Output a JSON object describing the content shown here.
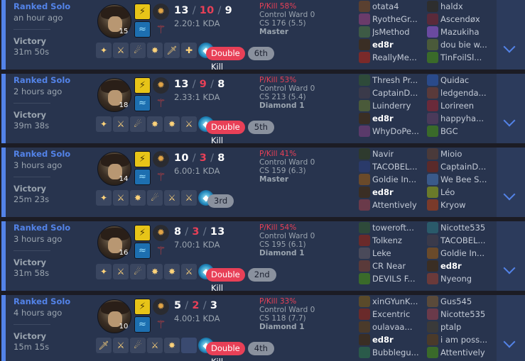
{
  "matches": [
    {
      "queue": "Ranked Solo",
      "ago": "an hour ago",
      "result": "Victory",
      "duration": "31m 50s",
      "level": "15",
      "kills": "13",
      "deaths": "10",
      "assists": "9",
      "kda": "2.20:1 KDA",
      "pkill": "P/Kill 58%",
      "control_ward": "Control Ward 0",
      "cs": "CS 176 (5.5)",
      "tier": "Master",
      "multikill": "Double Kill",
      "placement": "6th",
      "items": [
        "✦",
        "⚔",
        "☄",
        "✸",
        "🗡",
        "✚",
        "◆"
      ],
      "team1": [
        {
          "name": "otata4",
          "color": "#5a4030"
        },
        {
          "name": "RyotheGr...",
          "color": "#6a3b6a"
        },
        {
          "name": "JsMethod",
          "color": "#3d5a45"
        },
        {
          "name": "ed8r",
          "color": "#3a2e24",
          "me": true
        },
        {
          "name": "ReallyMe...",
          "color": "#7a2a2a"
        }
      ],
      "team2": [
        {
          "name": "haldx",
          "color": "#2e2e2e"
        },
        {
          "name": "Ascendøx",
          "color": "#5a2a3a"
        },
        {
          "name": "Mazukiha",
          "color": "#6a4aa0"
        },
        {
          "name": "dou bie w...",
          "color": "#4a5a3a"
        },
        {
          "name": "TinFoilSl...",
          "color": "#3a6a2a"
        }
      ]
    },
    {
      "queue": "Ranked Solo",
      "ago": "2 hours ago",
      "result": "Victory",
      "duration": "39m 38s",
      "level": "18",
      "kills": "13",
      "deaths": "9",
      "assists": "8",
      "kda": "2.33:1 KDA",
      "pkill": "P/Kill 53%",
      "control_ward": "Control Ward 0",
      "cs": "CS 213 (5.4)",
      "tier": "Diamond 1",
      "multikill": "Double Kill",
      "placement": "5th",
      "items": [
        "✦",
        "⚔",
        "☄",
        "✸",
        "✸",
        "⚔",
        "◆"
      ],
      "team1": [
        {
          "name": "Thresh Pr...",
          "color": "#2e4a3a"
        },
        {
          "name": "CaptainD...",
          "color": "#3a3a4a"
        },
        {
          "name": "Luinderry",
          "color": "#4a5a3a"
        },
        {
          "name": "ed8r",
          "color": "#3a2e24",
          "me": true
        },
        {
          "name": "WhyDoPe...",
          "color": "#5a3a6a"
        }
      ],
      "team2": [
        {
          "name": "Quidac",
          "color": "#2a4a8a"
        },
        {
          "name": "ledgenda...",
          "color": "#5a3a3a"
        },
        {
          "name": "Lorireen",
          "color": "#6a2a3a"
        },
        {
          "name": "happyha...",
          "color": "#4a3a5a"
        },
        {
          "name": "BGC",
          "color": "#3a6a2a"
        }
      ]
    },
    {
      "queue": "Ranked Solo",
      "ago": "3 hours ago",
      "result": "Victory",
      "duration": "25m 23s",
      "level": "14",
      "kills": "10",
      "deaths": "3",
      "assists": "8",
      "kda": "6.00:1 KDA",
      "pkill": "P/Kill 41%",
      "control_ward": "Control Ward 0",
      "cs": "CS 159 (6.3)",
      "tier": "Master",
      "multikill": "",
      "placement": "3rd",
      "items": [
        "✦",
        "⚔",
        "✸",
        "☄",
        "⚔",
        "⚔",
        "◆"
      ],
      "team1": [
        {
          "name": "Navir",
          "color": "#2e3a2e"
        },
        {
          "name": "TACOBEL...",
          "color": "#2a3a6a"
        },
        {
          "name": "Goldie In...",
          "color": "#6a4a2a"
        },
        {
          "name": "ed8r",
          "color": "#3a2e24",
          "me": true
        },
        {
          "name": "Attentively",
          "color": "#6a3a4a"
        }
      ],
      "team2": [
        {
          "name": "Mioio",
          "color": "#4a3a3a"
        },
        {
          "name": "CaptainD...",
          "color": "#5a2a2a"
        },
        {
          "name": "We Bee S...",
          "color": "#3a5a8a"
        },
        {
          "name": "Léo",
          "color": "#6a7a2a"
        },
        {
          "name": "Kryow",
          "color": "#7a3a2a"
        }
      ]
    },
    {
      "queue": "Ranked Solo",
      "ago": "3 hours ago",
      "result": "Victory",
      "duration": "31m 58s",
      "level": "16",
      "kills": "8",
      "deaths": "3",
      "assists": "13",
      "kda": "7.00:1 KDA",
      "pkill": "P/Kill 54%",
      "control_ward": "Control Ward 0",
      "cs": "CS 195 (6.1)",
      "tier": "Diamond 1",
      "multikill": "Double Kill",
      "placement": "2nd",
      "items": [
        "✦",
        "⚔",
        "☄",
        "✸",
        "✸",
        "⚔",
        "◆"
      ],
      "team1": [
        {
          "name": "toweroft...",
          "color": "#2e4a3a"
        },
        {
          "name": "Tolkenz",
          "color": "#6a2a2a"
        },
        {
          "name": "Leke",
          "color": "#4a4a5a"
        },
        {
          "name": "CR Near",
          "color": "#5a3a3a"
        },
        {
          "name": "DEVILS F...",
          "color": "#3a6a2a"
        }
      ],
      "team2": [
        {
          "name": "Nicotte535",
          "color": "#2a5a6a"
        },
        {
          "name": "TACOBEL...",
          "color": "#3a3a4a"
        },
        {
          "name": "Goldie In...",
          "color": "#6a4a2a"
        },
        {
          "name": "ed8r",
          "color": "#3a2e24",
          "me": true
        },
        {
          "name": "Nyeong",
          "color": "#6a3a3a"
        }
      ]
    },
    {
      "queue": "Ranked Solo",
      "ago": "4 hours ago",
      "result": "Victory",
      "duration": "15m 15s",
      "level": "10",
      "kills": "5",
      "deaths": "2",
      "assists": "3",
      "kda": "4.00:1 KDA",
      "pkill": "P/Kill 33%",
      "control_ward": "Control Ward 0",
      "cs": "CS 118 (7.7)",
      "tier": "Diamond 1",
      "multikill": "Double Kill",
      "placement": "4th",
      "items": [
        "🗡",
        "⚔",
        "☄",
        "⚔",
        "✸",
        "",
        "◆"
      ],
      "team1": [
        {
          "name": "xinGYunK...",
          "color": "#5a4a2a"
        },
        {
          "name": "Excentric",
          "color": "#6a2a2a"
        },
        {
          "name": "oulavaa...",
          "color": "#4a3a2a"
        },
        {
          "name": "ed8r",
          "color": "#3a2e24",
          "me": true
        },
        {
          "name": "Bubblegu...",
          "color": "#2a5a4a"
        }
      ],
      "team2": [
        {
          "name": "Gus545",
          "color": "#5a4a3a"
        },
        {
          "name": "Nicotte535",
          "color": "#6a3a4a"
        },
        {
          "name": "ptalp",
          "color": "#3a3a3a"
        },
        {
          "name": "i am poss...",
          "color": "#4a3a2a"
        },
        {
          "name": "Attentively",
          "color": "#3a6a2a"
        }
      ]
    }
  ]
}
